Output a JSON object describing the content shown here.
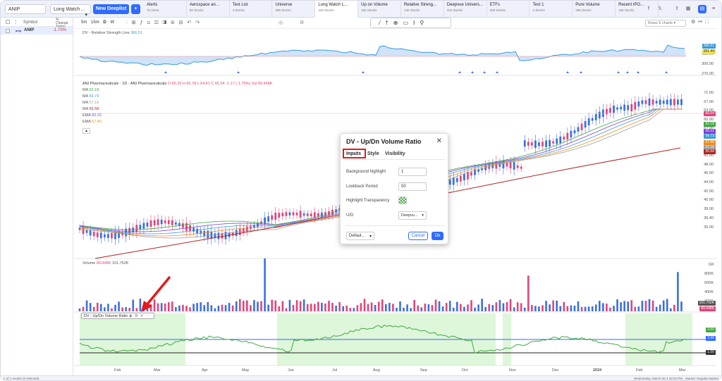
{
  "topbar": {
    "symbol_value": "ANIP",
    "watchlist_value": "Long Watch ...",
    "new_deeplist_label": "New Deeplist",
    "add_label": "+",
    "tabs": [
      {
        "title": "Alerts",
        "sub": "75 Alerts"
      },
      {
        "title": "Aerospace an...",
        "sub": "66 Stocks"
      },
      {
        "title": "Test List",
        "sub": "4 Stocks"
      },
      {
        "title": "Universe",
        "sub": "285 Stocks"
      },
      {
        "title": "Long Watch L...",
        "sub": "220 Stocks"
      },
      {
        "title": "Up on Volume",
        "sub": "162 Stocks"
      },
      {
        "title": "Relative Streng...",
        "sub": "146 Stocks"
      },
      {
        "title": "Deepvue Univers...",
        "sub": "334 Stocks"
      },
      {
        "title": "ETFs",
        "sub": "409 Stocks"
      },
      {
        "title": "Test 1",
        "sub": "0 Stocks"
      },
      {
        "title": "Pure Volume",
        "sub": "295 Stocks"
      },
      {
        "title": "Recent IPO...",
        "sub": "196 Stocks"
      }
    ]
  },
  "watchlist": {
    "col_symbol": "Symbol",
    "col_change": "% Change Today",
    "row_symbol": "ANIP",
    "row_change": "-1.75%"
  },
  "chart_toolbar": {
    "timeframes": [
      "5m",
      "15m",
      "D",
      "W"
    ],
    "rows_label": "Rows 5 charts"
  },
  "rs_pane": {
    "title": "DV - Relative Strength Line",
    "value": "366.51",
    "axis": [
      "330.00",
      "300.00",
      "270.00"
    ],
    "tag1": "366.51",
    "tag2": "361.44"
  },
  "price_pane": {
    "title": "ANI Pharmaceuticals · 1D · ANI Pharmaceuticals",
    "ohlc": "O 65.29  H 66.78  L 64.41  C 65.54  -1.17 (-1.75%)  Vol 89.448K",
    "ma_lines": [
      {
        "label": "MA",
        "value": "62.18",
        "color": "#3fa93f"
      },
      {
        "label": "MA",
        "value": "59.73",
        "color": "#3b9bd8"
      },
      {
        "label": "MA",
        "value": "57.16",
        "color": "#9c9c9c"
      },
      {
        "label": "MA",
        "value": "55.58",
        "color": "#b22222"
      },
      {
        "label": "EMA",
        "value": "60.22",
        "color": "#7b3fd8"
      },
      {
        "label": "EMA",
        "value": "57.40",
        "color": "#f08c1e"
      }
    ],
    "axis": [
      "71.00",
      "67.00",
      "63.00",
      "60.00",
      "57.00",
      "55.00",
      "52.00",
      "50.00",
      "48.00",
      "46.00",
      "44.00",
      "42.00",
      "40.00",
      "38.00",
      "36.40",
      "35.00"
    ],
    "tags": [
      {
        "v": "65.54",
        "c": "#e0457b"
      },
      {
        "v": "62.18",
        "c": "#3fa93f"
      },
      {
        "v": "60.22",
        "c": "#7b3fd8"
      },
      {
        "v": "59.73",
        "c": "#3b9bd8"
      },
      {
        "v": "57.40",
        "c": "#f08c1e"
      },
      {
        "v": "57.16",
        "c": "#9c9c9c"
      },
      {
        "v": "55.58",
        "c": "#b22222"
      }
    ]
  },
  "volume_pane": {
    "title": "Volume",
    "v1": "89.448K",
    "v2": "101.752K",
    "axis": [
      "1M",
      "800K",
      "600K",
      "400K",
      "200K"
    ],
    "tag1": "101.752K",
    "tag2": "89.448K"
  },
  "updn_pane": {
    "title": "DV - Up/Dn Volume Ratio",
    "tags": [
      "2.50",
      "2.00",
      "1.00"
    ]
  },
  "x_axis": [
    "Feb",
    "Mar",
    "Apr",
    "May",
    "Jun",
    "Jul",
    "Aug",
    "Sep",
    "Oct",
    "Nov",
    "Dec",
    "2024",
    "Feb",
    "Mar"
  ],
  "dialog": {
    "title": "DV - Up/Dn Volume Ratio",
    "tabs": [
      "Inputs",
      "Style",
      "Visibility"
    ],
    "fields": [
      {
        "label": "Background highlight",
        "value": "1"
      },
      {
        "label": "Lookback Period",
        "value": "50"
      },
      {
        "label": "Highlight Transparency",
        "value": ""
      },
      {
        "label": "U/D",
        "value": "Deepvu..."
      }
    ],
    "defaults_label": "Defaul...",
    "cancel_label": "Cancel",
    "ok_label": "Ok"
  },
  "status": {
    "left": "1 of 1 results (0 selected)",
    "right": "Wednesday, March 06 4:33:03 PM  ·  Market: Regular Market"
  }
}
